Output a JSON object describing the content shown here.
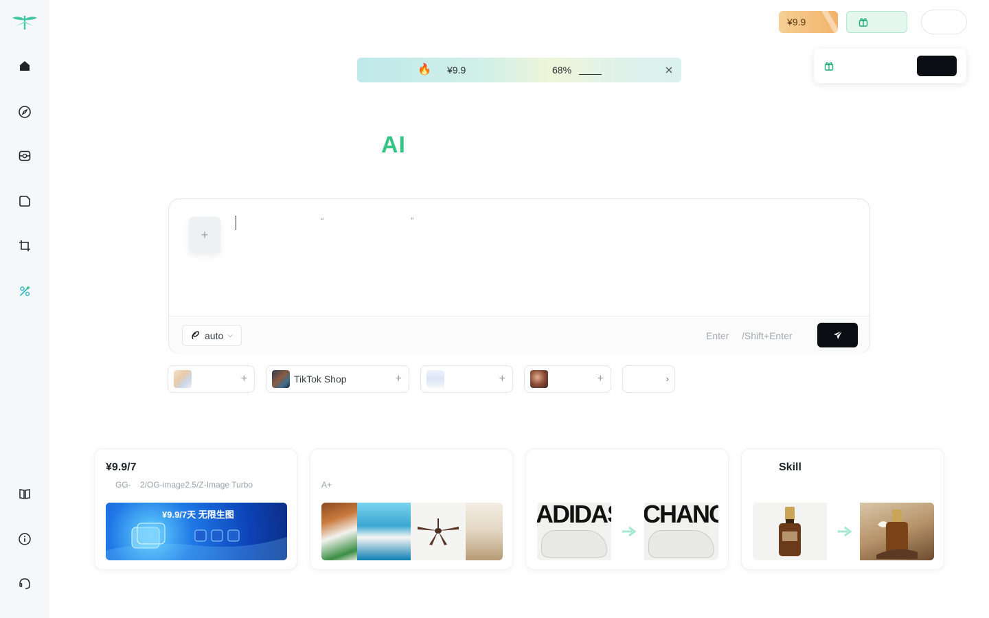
{
  "top_bar": {
    "price_pill": "¥9.9"
  },
  "promo": {
    "price": "¥9.9",
    "percent": "68%",
    "fire_icon": "🔥"
  },
  "hero": {
    "title": "AI"
  },
  "composer": {
    "plus": "+",
    "quote_open": "“",
    "quote_close": "”",
    "model_label": "auto",
    "chevron": "⌵",
    "hint_enter": "Enter",
    "hint_shift": "/Shift+Enter"
  },
  "chips": [
    {
      "label": "",
      "plus": "+"
    },
    {
      "label": "TikTok Shop",
      "plus": "+"
    },
    {
      "label": "",
      "plus": "+"
    },
    {
      "label": "",
      "plus": "+"
    },
    {
      "label": "",
      "arrow": "›"
    }
  ],
  "cards": [
    {
      "title": "¥9.9/7",
      "sub": "GG-",
      "sub2": "2/OG-image2.5/Z-Image Turbo",
      "banner_text": "¥9.9/7天 无限生图"
    },
    {
      "title": "",
      "sub": "A+"
    },
    {
      "title": "",
      "img_left": "ADIDAS",
      "img_right": "CHANGE"
    },
    {
      "title": "Skill"
    }
  ],
  "colors": {
    "accent": "#34c483",
    "dark": "#0b0f14"
  }
}
